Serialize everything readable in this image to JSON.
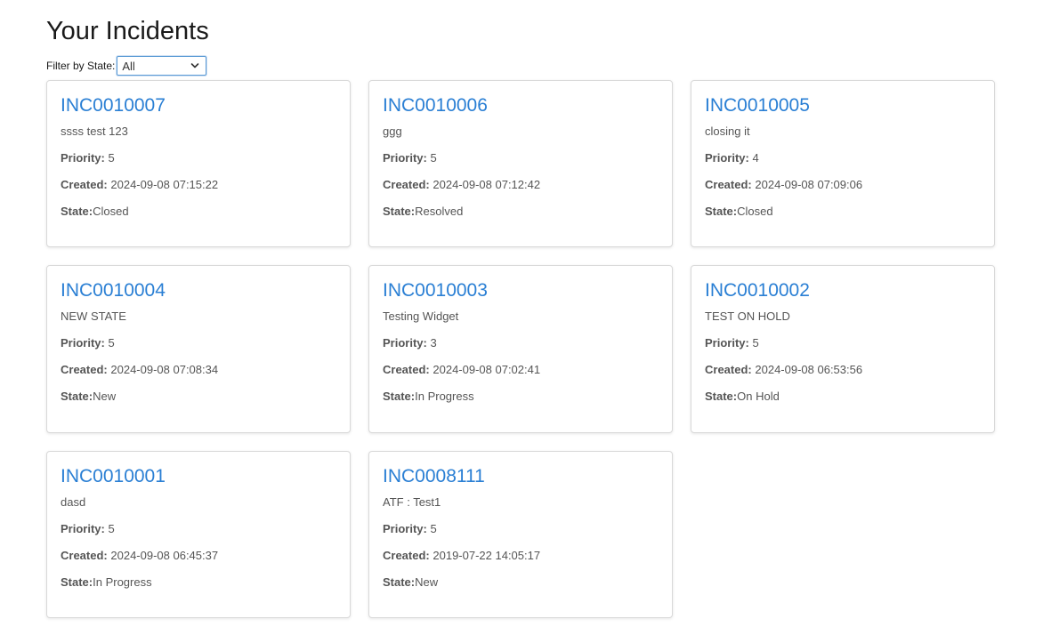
{
  "page": {
    "title": "Your Incidents"
  },
  "filter": {
    "label": "Filter by State:",
    "selected": "All"
  },
  "labels": {
    "priority": "Priority:",
    "created": "Created:",
    "state": "State:"
  },
  "incidents": [
    {
      "number": "INC0010007",
      "description": "ssss test 123",
      "priority": "5",
      "created": "2024-09-08 07:15:22",
      "state": "Closed"
    },
    {
      "number": "INC0010006",
      "description": "ggg",
      "priority": "5",
      "created": "2024-09-08 07:12:42",
      "state": "Resolved"
    },
    {
      "number": "INC0010005",
      "description": "closing it",
      "priority": "4",
      "created": "2024-09-08 07:09:06",
      "state": "Closed"
    },
    {
      "number": "INC0010004",
      "description": "NEW STATE",
      "priority": "5",
      "created": "2024-09-08 07:08:34",
      "state": "New"
    },
    {
      "number": "INC0010003",
      "description": "Testing Widget",
      "priority": "3",
      "created": "2024-09-08 07:02:41",
      "state": "In Progress"
    },
    {
      "number": "INC0010002",
      "description": "TEST ON HOLD",
      "priority": "5",
      "created": "2024-09-08 06:53:56",
      "state": "On Hold"
    },
    {
      "number": "INC0010001",
      "description": "dasd",
      "priority": "5",
      "created": "2024-09-08 06:45:37",
      "state": "In Progress"
    },
    {
      "number": "INC0008111",
      "description": "ATF : Test1",
      "priority": "5",
      "created": "2019-07-22 14:05:17",
      "state": "New"
    }
  ]
}
